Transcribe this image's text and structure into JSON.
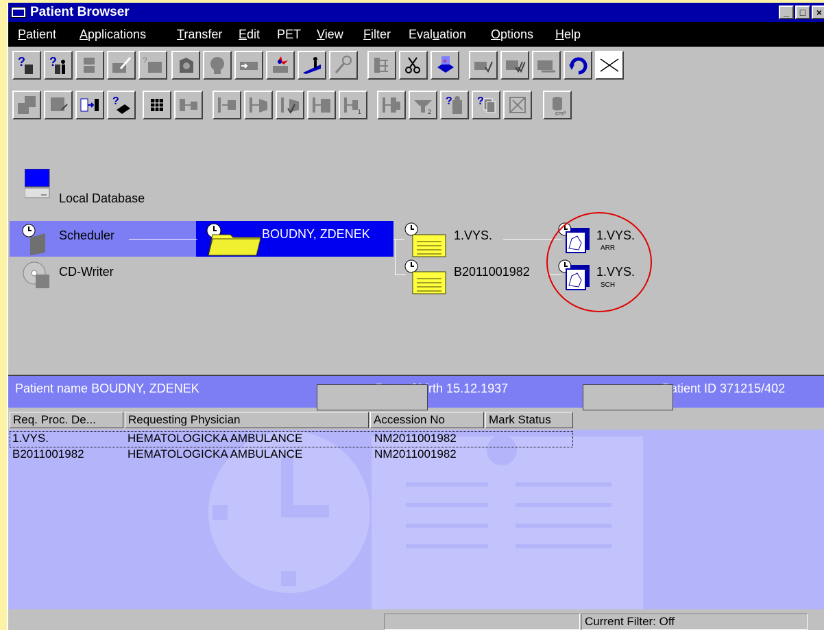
{
  "window": {
    "title": "Patient Browser",
    "controls": [
      "_",
      "□",
      "×"
    ]
  },
  "menu": [
    {
      "label": "Patient",
      "key": "P"
    },
    {
      "label": "Applications",
      "key": "A"
    },
    {
      "label": "Transfer",
      "key": "T"
    },
    {
      "label": "Edit",
      "key": "E"
    },
    {
      "label": "PET",
      "key": ""
    },
    {
      "label": "View",
      "key": "V"
    },
    {
      "label": "Filter",
      "key": "F"
    },
    {
      "label": "Evaluation",
      "key": "u"
    },
    {
      "label": "Options",
      "key": "O"
    },
    {
      "label": "Help",
      "key": "H"
    }
  ],
  "toolbar1": [
    "query-patient-icon",
    "query-study-icon",
    "import-icon",
    "edit-icon",
    "tagged-folder-icon",
    "film-icon",
    "head-icon",
    "send-icon",
    "anonymize-icon",
    "scheduler-icon",
    "tool-icon",
    "tree-icon",
    "cut-icon",
    "archive-icon",
    "check-icon",
    "check-all-icon",
    "check-ok-icon",
    "refresh-icon",
    "close-x-icon"
  ],
  "toolbar2": [
    "copy-icon",
    "move-icon",
    "transfer-icon",
    "query-transfer-icon",
    "grid-icon",
    "send-out-icon",
    "series-first-icon",
    "series-prev-icon",
    "series-check-icon",
    "series-next-icon",
    "series-one-icon",
    "series-last-icon",
    "series-two-icon",
    "help-series-icon",
    "help-copy-icon",
    "no-transfer-icon",
    "volume-icon"
  ],
  "tree": {
    "local_database": "Local Database",
    "scheduler": "Scheduler",
    "cd_writer": "CD-Writer",
    "patient": "BOUDNY, ZDENEK",
    "study1": "1.VYS.",
    "study2": "B2011001982",
    "series1": {
      "label": "1.VYS.",
      "tag": "ARR"
    },
    "series2": {
      "label": "1.VYS.",
      "tag": "SCH"
    }
  },
  "info": {
    "patient_name": "Patient name BOUDNY, ZDENEK",
    "dob": "Date of birth 15.12.1937",
    "patient_id": "Patient ID 371215/402"
  },
  "table": {
    "headers": [
      "Req. Proc. De...",
      "Requesting Physician",
      "Accession No",
      "Mark Status"
    ],
    "rows": [
      [
        "1.VYS.",
        "HEMATOLOGICKA AMBULANCE",
        "NM2011001982",
        ""
      ],
      [
        "B2011001982",
        "HEMATOLOGICKA AMBULANCE",
        "NM2011001982",
        ""
      ]
    ]
  },
  "status": {
    "filter": "Current Filter: Off"
  },
  "colors": {
    "title": "#0000a8",
    "selection": "#0000f0",
    "panel": "#7e7ef4",
    "table_bg": "#b4b4fa",
    "folder": "#ffff40",
    "annotation": "#e00000"
  }
}
